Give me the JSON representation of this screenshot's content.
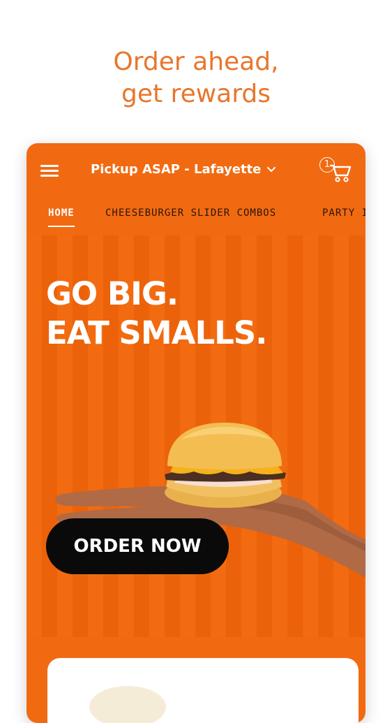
{
  "tagline": {
    "line1": "Order ahead,",
    "line2": "get rewards"
  },
  "header": {
    "location_label": "Pickup ASAP - Lafayette",
    "cart_count": "1"
  },
  "tabs": [
    {
      "label": "HOME",
      "active": true
    },
    {
      "label": "CHEESEBURGER SLIDER COMBOS",
      "active": false
    },
    {
      "label": "PARTY I",
      "active": false
    }
  ],
  "hero": {
    "headline_line1": "GO BIG.",
    "headline_line2": "EAT SMALLS.",
    "cta_label": "ORDER NOW"
  },
  "colors": {
    "accent": "#f16a12",
    "tagline": "#e8762c",
    "cta_background": "#0a0a0a",
    "text_on_accent": "#ffffff"
  },
  "icons": [
    "menu-icon",
    "chevron-down-icon",
    "cart-icon"
  ]
}
